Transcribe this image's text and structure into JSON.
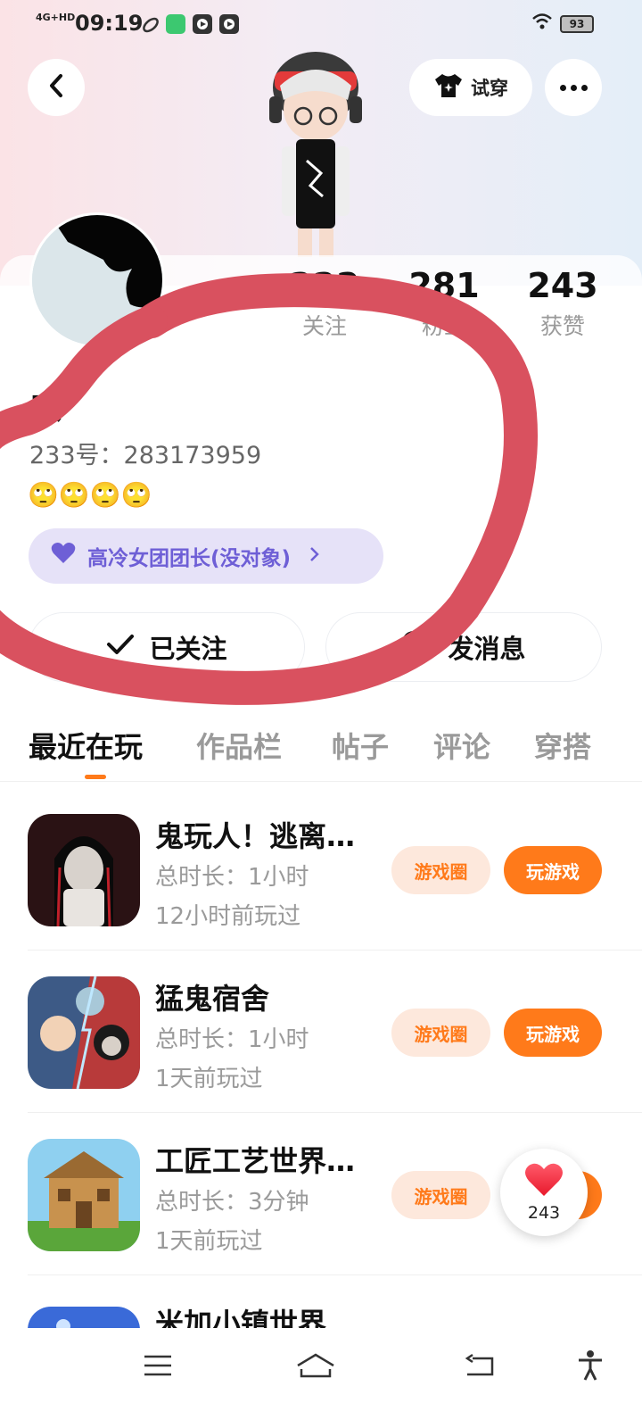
{
  "status_bar": {
    "network": "4G+HD",
    "time": "09:19",
    "battery": "93"
  },
  "header": {
    "try_on_label": "试穿"
  },
  "profile": {
    "stats": [
      {
        "value": "222",
        "label": "关注"
      },
      {
        "value": "281",
        "label": "粉丝"
      },
      {
        "value": "243",
        "label": "获赞"
      }
    ],
    "username": "庆",
    "user_id": "233号：283173959",
    "bio_emojis": "🙄🙄🙄🙄",
    "group_tag": "高冷女团团长(没对象)",
    "follow_button": "已关注",
    "message_button": "发消息"
  },
  "tabs": [
    "最近在玩",
    "作品栏",
    "帖子",
    "评论",
    "穿搭"
  ],
  "games": [
    {
      "name": "鬼玩人！逃离…",
      "duration": "总时长：1小时",
      "last_played": "12小时前玩过",
      "circle_label": "游戏圈",
      "play_label": "玩游戏"
    },
    {
      "name": "猛鬼宿舍",
      "duration": "总时长：1小时",
      "last_played": "1天前玩过",
      "circle_label": "游戏圈",
      "play_label": "玩游戏"
    },
    {
      "name": "工匠工艺世界…",
      "duration": "总时长：3分钟",
      "last_played": "1天前玩过",
      "circle_label": "游戏圈",
      "play_label": "玩游戏"
    },
    {
      "name": "米加小镇世界",
      "duration": "",
      "last_played": "",
      "circle_label": "",
      "play_label": ""
    }
  ],
  "like_float": {
    "count": "243"
  },
  "colors": {
    "accent": "#ff7a1a",
    "tag_purple": "#6e5fd6",
    "annotation_red": "#d9515f"
  }
}
